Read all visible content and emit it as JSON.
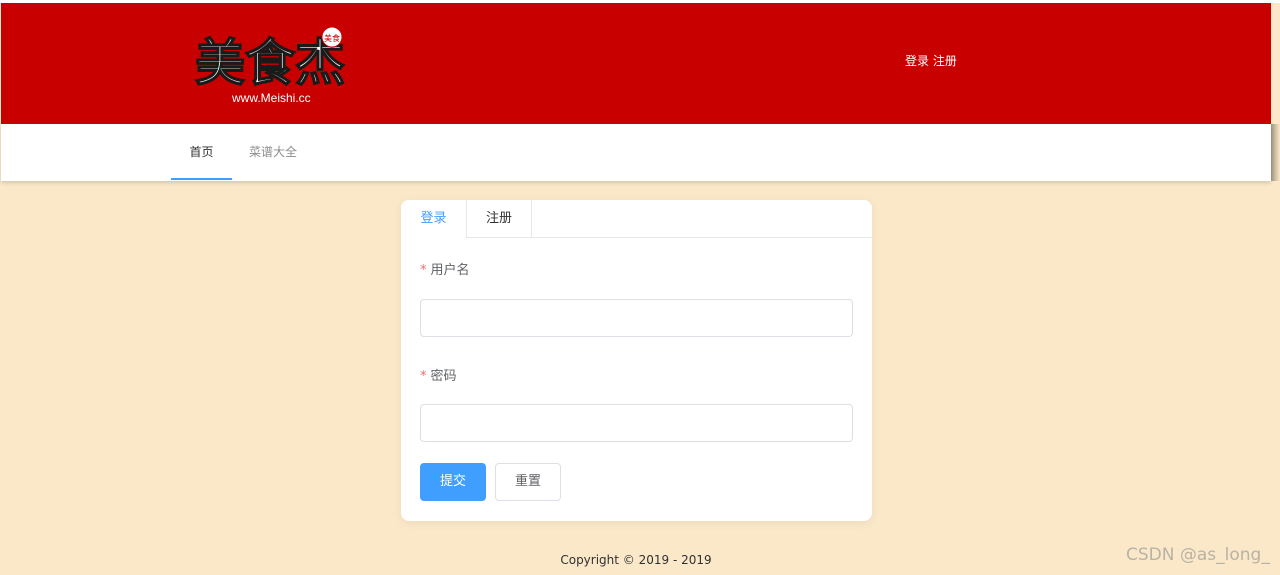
{
  "header": {
    "logo": {
      "brand_text": "美食杰",
      "seal_text": "美食",
      "url_text": "www.Meishi.cc"
    },
    "auth_links": {
      "login": "登录",
      "register": "注册"
    }
  },
  "nav": {
    "items": [
      {
        "label": "首页",
        "active": true
      },
      {
        "label": "菜谱大全",
        "active": false
      }
    ]
  },
  "login_card": {
    "tabs": [
      {
        "label": "登录",
        "active": true
      },
      {
        "label": "注册",
        "active": false
      }
    ],
    "fields": {
      "username": {
        "label": "用户名",
        "required_mark": "*",
        "value": ""
      },
      "password": {
        "label": "密码",
        "required_mark": "*",
        "value": ""
      }
    },
    "buttons": {
      "submit": "提交",
      "reset": "重置"
    }
  },
  "footer": {
    "copyright": "Copyright © 2019 - 2019"
  },
  "watermark": "CSDN @as_long_",
  "colors": {
    "header_red": "#c90000",
    "page_background": "#fae8c8",
    "accent_blue": "#409eff",
    "required_red": "#f56c6c"
  }
}
